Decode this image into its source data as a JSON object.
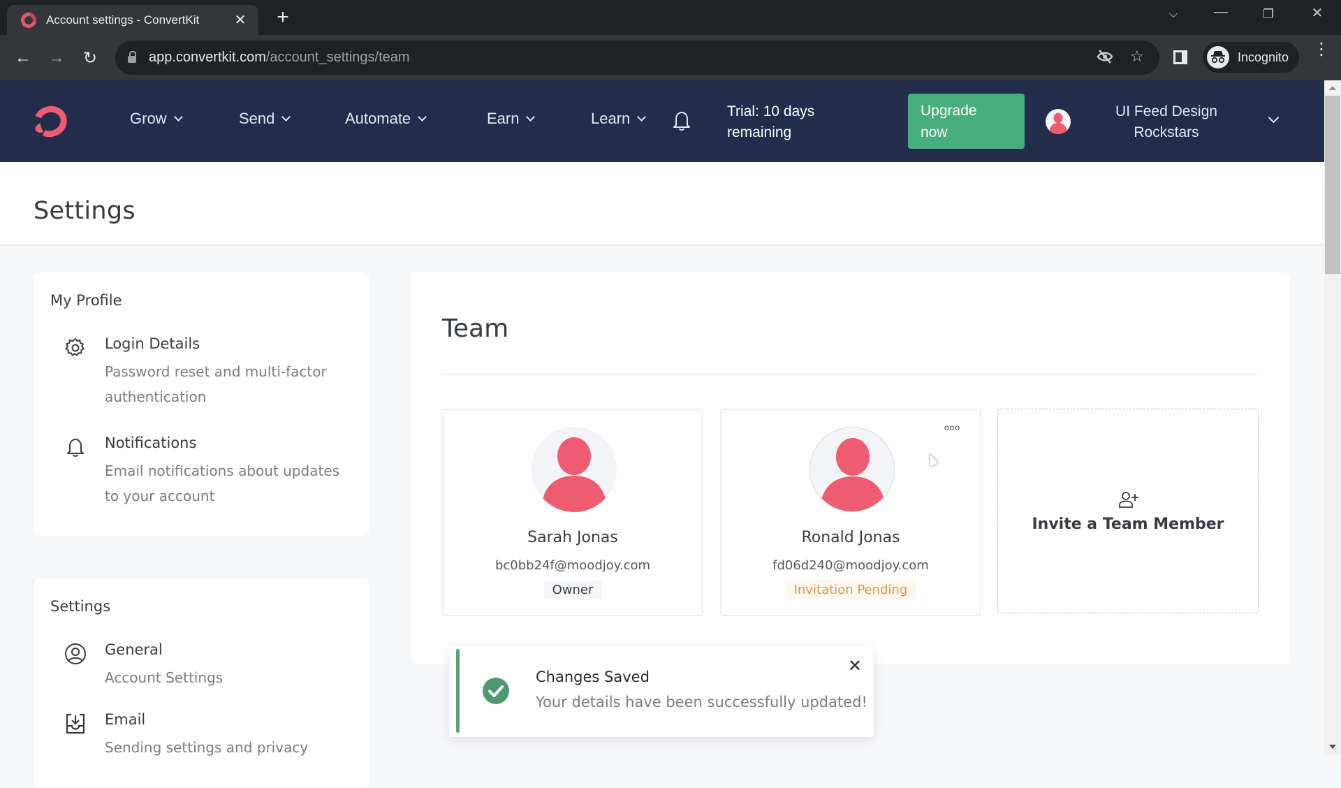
{
  "browser": {
    "tab_title": "Account settings - ConvertKit",
    "url_host": "app.convertkit.com",
    "url_path": "/account_settings/team",
    "profile_label": "Incognito"
  },
  "nav": {
    "menus": [
      {
        "label": "Grow"
      },
      {
        "label": "Send"
      },
      {
        "label": "Automate"
      },
      {
        "label": "Earn"
      },
      {
        "label": "Learn"
      }
    ],
    "trial_line1": "Trial: 10 days",
    "trial_line2": "remaining",
    "upgrade_line1": "Upgrade",
    "upgrade_line2": "now",
    "account_line1": "UI Feed Design",
    "account_line2": "Rockstars"
  },
  "page": {
    "title": "Settings"
  },
  "sidebar": {
    "sections": [
      {
        "heading": "My Profile",
        "items": [
          {
            "title": "Login Details",
            "desc": "Password reset and multi-factor authentication",
            "icon": "gear-icon"
          },
          {
            "title": "Notifications",
            "desc": "Email notifications about updates to your account",
            "icon": "bell-icon"
          }
        ]
      },
      {
        "heading": "Settings",
        "items": [
          {
            "title": "General",
            "desc": "Account Settings",
            "icon": "user-circle-icon"
          },
          {
            "title": "Email",
            "desc": "Sending settings and privacy",
            "icon": "inbox-download-icon"
          }
        ]
      }
    ]
  },
  "team": {
    "title": "Team",
    "members": [
      {
        "name": "Sarah Jonas",
        "email": "bc0bb24f@moodjoy.com",
        "role": "Owner"
      },
      {
        "name": "Ronald Jonas",
        "email": "fd06d240@moodjoy.com",
        "role": "Invitation Pending"
      }
    ],
    "invite_label": "Invite a Team Member",
    "more_label": "ooo"
  },
  "toast": {
    "title": "Changes Saved",
    "message": "Your details have been successfully updated!"
  },
  "colors": {
    "nav_bg": "#232c4a",
    "brand": "#ee5c72",
    "upgrade": "#48ad7c",
    "success": "#4e9a6f",
    "pending": "#d69a3e"
  }
}
